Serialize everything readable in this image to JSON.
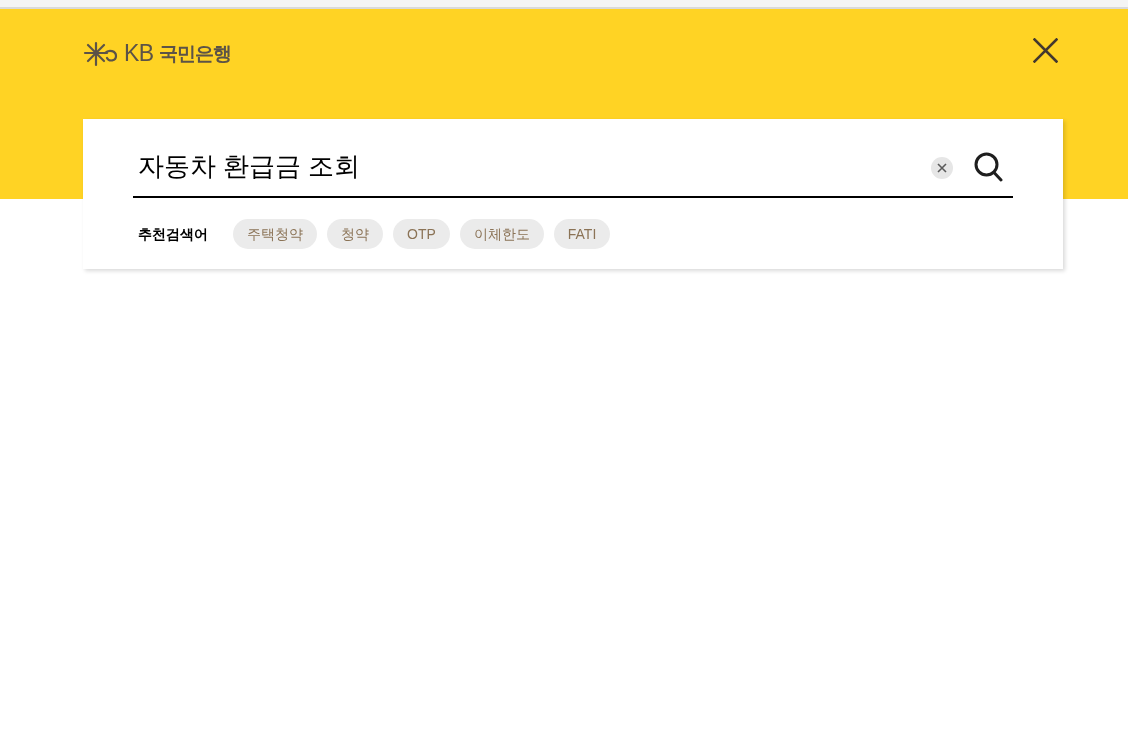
{
  "header": {
    "logo": {
      "abbr": "KB",
      "name": "국민은행"
    }
  },
  "search": {
    "value": "자동차 환급금 조회"
  },
  "recommended": {
    "label": "추천검색어",
    "keywords": [
      "주택청약",
      "청약",
      "OTP",
      "이체한도",
      "FATI"
    ]
  }
}
